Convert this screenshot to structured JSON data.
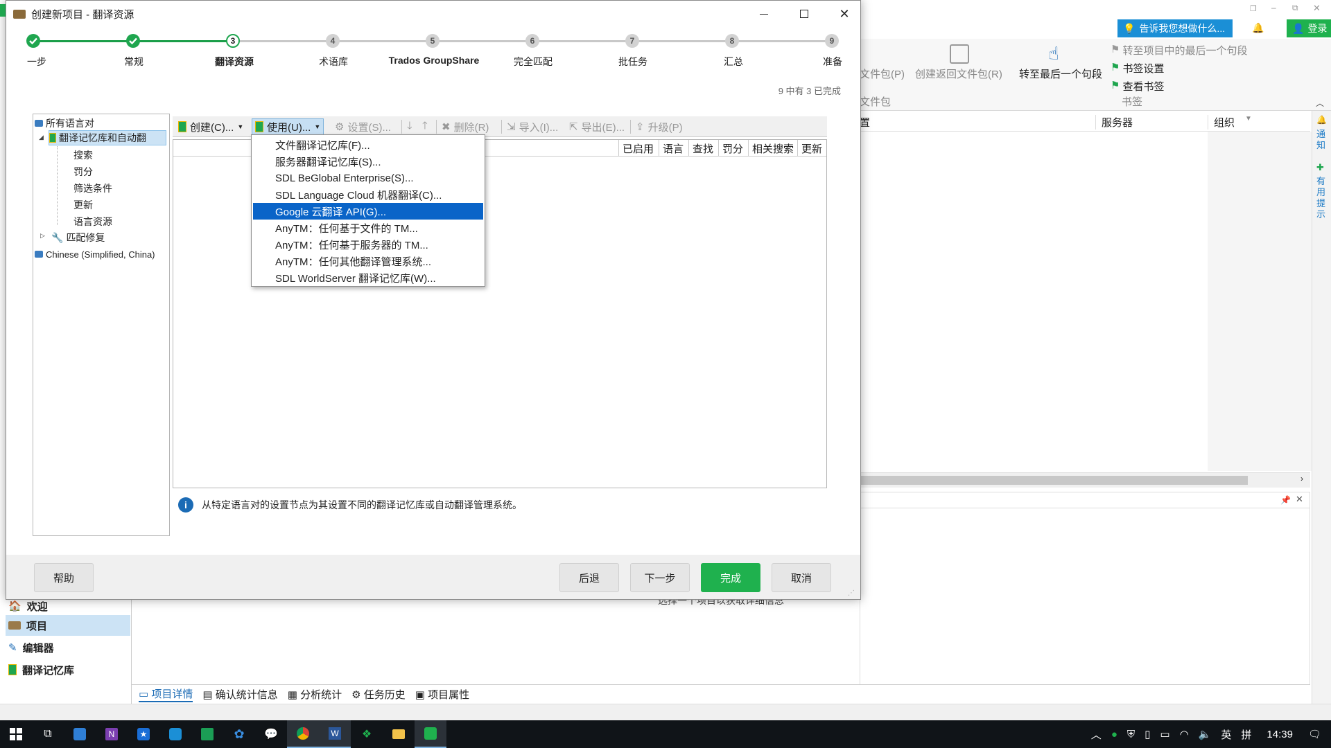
{
  "background_app": {
    "search_label": "告诉我您想做什么...",
    "login_label": "登录",
    "ribbon": {
      "file_pkg": "文件包(P)",
      "return_pkg": "创建返回文件包(R)",
      "goto_last": "转至最后一个句段",
      "goto_last_in_project": "转至项目中的最后一个句段",
      "bookmark_settings": "书签设置",
      "view_bookmarks": "查看书签",
      "group_file_pkg": "文件包",
      "group_bookmark": "书签"
    },
    "grid_headers": {
      "location": "置",
      "server": "服务器",
      "org": "组织"
    },
    "right_bar": {
      "notifications": "通知",
      "tips": "有用提示"
    },
    "nav": [
      {
        "label": "欢迎",
        "icon": "home-icon"
      },
      {
        "label": "项目",
        "icon": "projects-icon"
      },
      {
        "label": "编辑器",
        "icon": "editor-icon"
      },
      {
        "label": "翻译记忆库",
        "icon": "tm-icon"
      }
    ],
    "bottom_tabs": [
      "项目详情",
      "确认统计信息",
      "分析统计",
      "任务历史",
      "项目属性"
    ],
    "status_text": "选择一个项目以获取详细信息"
  },
  "dialog": {
    "title": "创建新项目 - 翻译资源",
    "steps": [
      {
        "num": "1",
        "label": "一步",
        "state": "done"
      },
      {
        "num": "2",
        "label": "常规",
        "state": "done"
      },
      {
        "num": "3",
        "label": "翻译资源",
        "state": "current"
      },
      {
        "num": "4",
        "label": "术语库",
        "state": "todo"
      },
      {
        "num": "5",
        "label": "Trados GroupShare",
        "state": "todo"
      },
      {
        "num": "6",
        "label": "完全匹配",
        "state": "todo"
      },
      {
        "num": "7",
        "label": "批任务",
        "state": "todo"
      },
      {
        "num": "8",
        "label": "汇总",
        "state": "todo"
      },
      {
        "num": "9",
        "label": "准备",
        "state": "todo"
      }
    ],
    "progress_text": "9 中有 3 已完成",
    "tree": {
      "root": "所有语言对",
      "tm_node": "翻译记忆库和自动翻",
      "children": [
        "搜索",
        "罚分",
        "筛选条件",
        "更新",
        "语言资源"
      ],
      "match_repair": "匹配修复",
      "lang_pair": "Chinese (Simplified, China)"
    },
    "toolbar": {
      "create": "创建(C)...",
      "use": "使用(U)...",
      "settings": "设置(S)...",
      "delete": "删除(R)",
      "import": "导入(I)...",
      "export": "导出(E)...",
      "upgrade": "升级(P)"
    },
    "grid_headers": [
      "已启用",
      "语言",
      "查找",
      "罚分",
      "相关搜索",
      "更新"
    ],
    "info_text": "从特定语言对的设置节点为其设置不同的翻译记忆库或自动翻译管理系统。",
    "use_menu": [
      "文件翻译记忆库(F)...",
      "服务器翻译记忆库(S)...",
      "SDL BeGlobal Enterprise(S)...",
      "SDL Language Cloud 机器翻译(C)...",
      "Google 云翻译 API(G)...",
      "AnyTM：任何基于文件的 TM...",
      "AnyTM：任何基于服务器的 TM...",
      "AnyTM：任何其他翻译管理系统...",
      "SDL WorldServer 翻译记忆库(W)..."
    ],
    "use_menu_highlighted": 4,
    "buttons": {
      "help": "帮助",
      "back": "后退",
      "next": "下一步",
      "finish": "完成",
      "cancel": "取消"
    }
  },
  "taskbar": {
    "time": "14:39",
    "ime": "英",
    "ime2": "拼"
  },
  "colors": {
    "accent_green": "#1fb14e",
    "menu_highlight": "#0a64c8",
    "selection": "#cce3f5"
  }
}
